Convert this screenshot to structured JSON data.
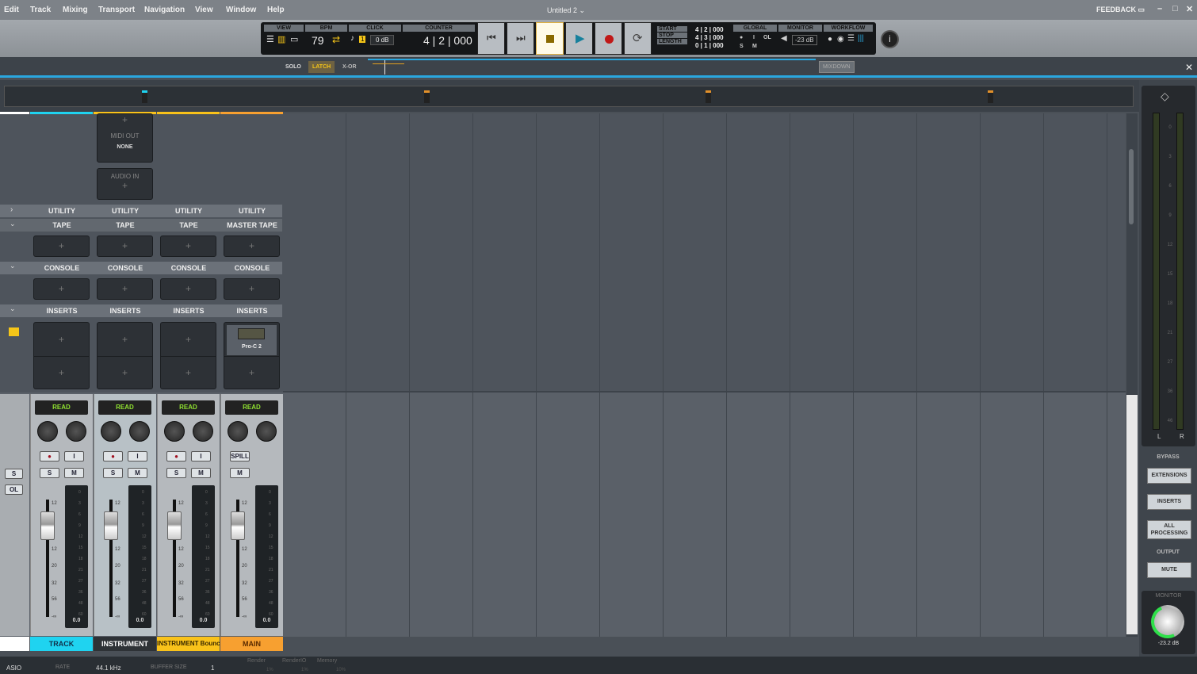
{
  "menu": [
    "Edit",
    "Track",
    "Mixing",
    "Transport",
    "Navigation",
    "View",
    "Window",
    "Help"
  ],
  "title": "Untitled 2",
  "feedback": "FEEDBACK",
  "transport": {
    "view_label": "VIEW",
    "bpm_label": "BPM",
    "bpm": "79",
    "click_label": "CLICK",
    "click_level": "0 dB",
    "click_count": "1",
    "counter_label": "COUNTER",
    "counter": "4 | 2 | 000",
    "start_label": "START",
    "stop_label": "STOP",
    "length_label": "LENGTH",
    "start": "4 | 2 | 000",
    "stop": "4 | 3 | 000",
    "length": "0 | 1 | 000",
    "global_label": "GLOBAL",
    "global_i": "I",
    "global_ol": "OL",
    "global_s": "S",
    "global_m": "M",
    "monitor_label": "MONITOR",
    "monitor_level": "-23 dB",
    "workflow_label": "WORKFLOW"
  },
  "solobar": {
    "solo": "SOLO",
    "latch": "LATCH",
    "xor": "X-OR",
    "mixdown": "MIXDOWN"
  },
  "sections": {
    "utility": "UTILITY",
    "console": "CONSOLE",
    "inserts": "INSERTS",
    "midi_out": "MIDI OUT",
    "midi_out_value": "NONE",
    "audio_in": "AUDIO IN"
  },
  "left_buttons": {
    "s": "S",
    "ol": "OL"
  },
  "scale": [
    "12",
    "6",
    "0",
    "6",
    "12",
    "20",
    "32",
    "56",
    "-∞"
  ],
  "meter_scale": [
    "0",
    "3",
    "6",
    "9",
    "12",
    "15",
    "18",
    "21",
    "27",
    "36",
    "48",
    "60"
  ],
  "channels": [
    {
      "name": "TRACK",
      "color": "#1fd3f0",
      "text": "#11304a",
      "tape": "TAPE",
      "auto": "READ",
      "value": "0.0",
      "insert": null
    },
    {
      "name": "INSTRUMENT",
      "color": "#2e3236",
      "text": "#ffffff",
      "tape": "TAPE",
      "auto": "READ",
      "value": "0.0",
      "insert": null
    },
    {
      "name": "INSTRUMENT Bounce",
      "color": "#f9c21a",
      "text": "#3a2a00",
      "tape": "TAPE",
      "auto": "READ",
      "value": "0.0",
      "insert": null
    },
    {
      "name": "MAIN",
      "color": "#f7a030",
      "text": "#5a2a00",
      "tape": "MASTER TAPE",
      "auto": "READ",
      "value": "0.0",
      "insert": "Pro-C 2",
      "main": true
    }
  ],
  "top_colors": [
    "#ffffff",
    "#1fd3f0",
    "#f9c21a",
    "#f9c21a",
    "#f7a030"
  ],
  "right_panel": {
    "meter_l": "L",
    "meter_r": "R",
    "meter_scale": [
      "0",
      "3",
      "6",
      "9",
      "12",
      "15",
      "18",
      "21",
      "27",
      "36",
      "46"
    ],
    "bypass": "BYPASS",
    "extensions": "EXTENSIONS",
    "inserts": "INSERTS",
    "all_processing": "ALL PROCESSING",
    "output": "OUTPUT",
    "mute": "MUTE",
    "monitor": "MONITOR",
    "monitor_value": "-23.2 dB"
  },
  "status": {
    "driver": "ASIO",
    "rate_label": "RATE",
    "rate": "44.1 kHz",
    "buffer_label": "BUFFER SIZE",
    "buffer": "1",
    "render_label": "Render",
    "render": "1%",
    "renderio_label": "RenderIO",
    "renderio": "1%",
    "memory_label": "Memory",
    "memory": "10%"
  }
}
